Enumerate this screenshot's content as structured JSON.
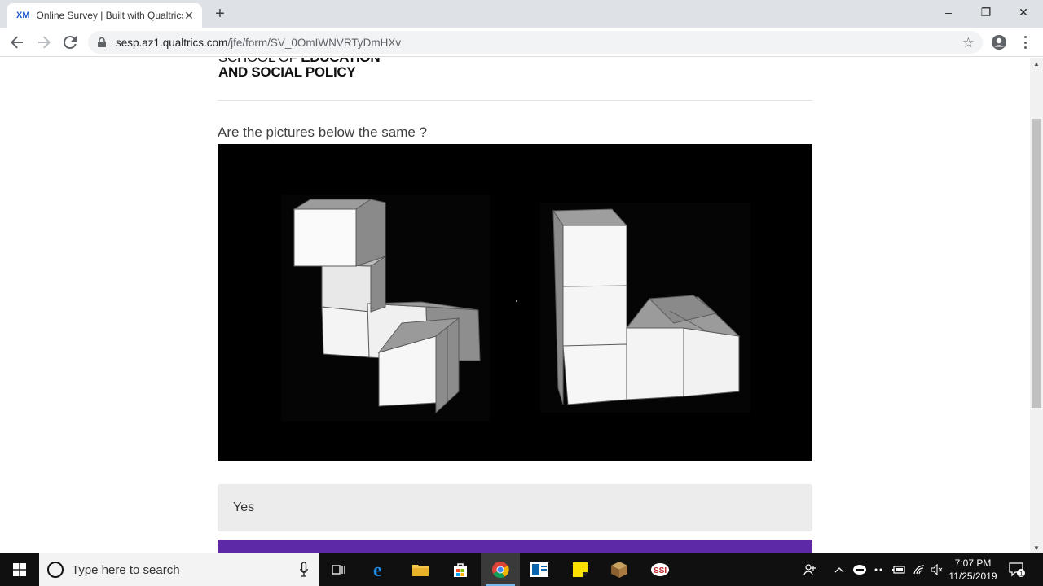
{
  "browser": {
    "tab_logo": "XM",
    "tab_title": "Online Survey | Built with Qualtrics Experience Management",
    "url_host": "sesp.az1.qualtrics.com",
    "url_path": "/jfe/form/SV_0OmIWNVRTyDmHXv",
    "window_controls": {
      "minimize": "–",
      "restore": "❐",
      "close": "✕"
    }
  },
  "survey": {
    "logo_line1_thin": "SCHOOL OF ",
    "logo_line1_bold": "EDUCATION",
    "logo_line2": "AND SOCIAL POLICY",
    "question": "Are the pictures below the same ?",
    "choices": [
      "Yes"
    ]
  },
  "taskbar": {
    "search_placeholder": "Type here to search",
    "time": "7:07 PM",
    "date": "11/25/2019",
    "notifications_count": "1"
  },
  "icons": {
    "back": "arrow-left-icon",
    "forward": "arrow-right-icon",
    "reload": "reload-icon",
    "lock": "lock-icon",
    "bookmark": "star-icon",
    "profile": "account-icon",
    "menu": "kebab-menu-icon"
  },
  "colors": {
    "submit_button": "#5e29a7",
    "choice_background": "#ececec",
    "stimulus_background": "#000000"
  }
}
